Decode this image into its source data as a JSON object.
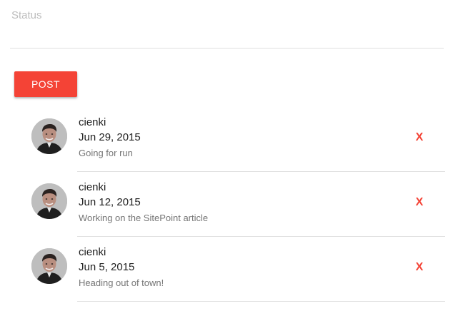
{
  "status": {
    "placeholder": "Status",
    "value": ""
  },
  "post_button": {
    "label": "POST"
  },
  "feed": {
    "items": [
      {
        "username": "cienki",
        "date": "Jun 29, 2015",
        "text": "Going for run",
        "delete_label": "X"
      },
      {
        "username": "cienki",
        "date": "Jun 12, 2015",
        "text": "Working on the SitePoint article",
        "delete_label": "X"
      },
      {
        "username": "cienki",
        "date": "Jun 5, 2015",
        "text": "Heading out of town!",
        "delete_label": "X"
      }
    ]
  },
  "colors": {
    "accent": "#f44336",
    "divider": "#e0e0e0",
    "secondary_text": "#757575",
    "placeholder": "#bdbdbd"
  },
  "icons": {
    "avatar": "user-avatar-photo"
  }
}
